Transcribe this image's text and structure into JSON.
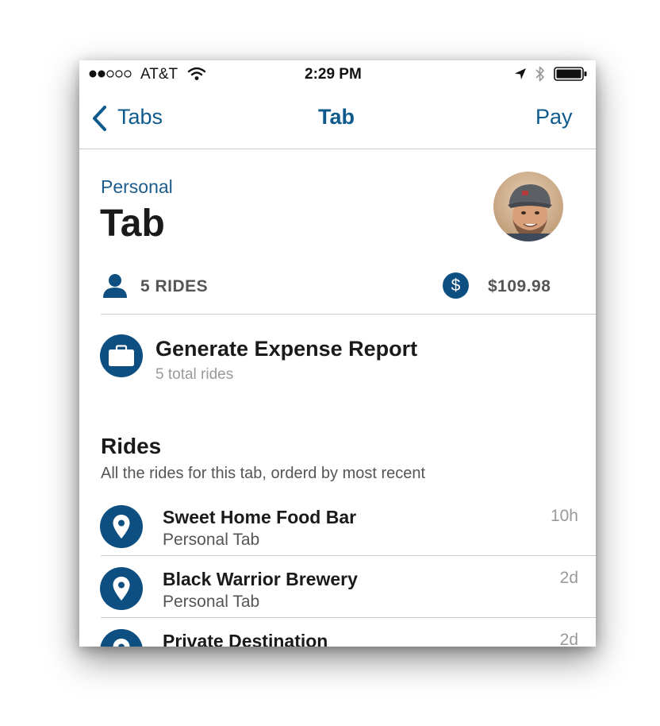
{
  "colors": {
    "accent": "#0f5a8c",
    "icon_blue": "#0e4f82",
    "text_dark": "#1a1a1a",
    "text_gray": "#555555",
    "text_light": "#9a9a9a",
    "divider": "#c9c9cc"
  },
  "status_bar": {
    "carrier": "AT&T",
    "signal_icon": "signal-dots-icon",
    "wifi_icon": "wifi-icon",
    "time": "2:29 PM",
    "location_icon": "location-arrow-icon",
    "bluetooth_icon": "bluetooth-icon",
    "battery_icon": "battery-icon"
  },
  "nav": {
    "back_label": "Tabs",
    "title": "Tab",
    "action_label": "Pay"
  },
  "header": {
    "subtitle": "Personal",
    "title": "Tab",
    "avatar_icon": "user-photo-avatar"
  },
  "stats": {
    "rides_label": "5 RIDES",
    "rides_icon": "person-icon",
    "amount": "$109.98",
    "amount_icon": "dollar-circle-icon"
  },
  "expense_report": {
    "title": "Generate Expense Report",
    "subtitle": "5 total rides",
    "icon": "briefcase-icon"
  },
  "rides_section": {
    "title": "Rides",
    "description": "All the rides for this tab, orderd by most recent",
    "items": [
      {
        "name": "Sweet Home Food Bar",
        "tab": "Personal Tab",
        "time": "10h",
        "icon": "map-pin-icon"
      },
      {
        "name": "Black Warrior Brewery",
        "tab": "Personal Tab",
        "time": "2d",
        "icon": "map-pin-icon"
      },
      {
        "name": "Private Destination",
        "tab": "",
        "time": "2d",
        "icon": "map-pin-icon"
      }
    ]
  }
}
